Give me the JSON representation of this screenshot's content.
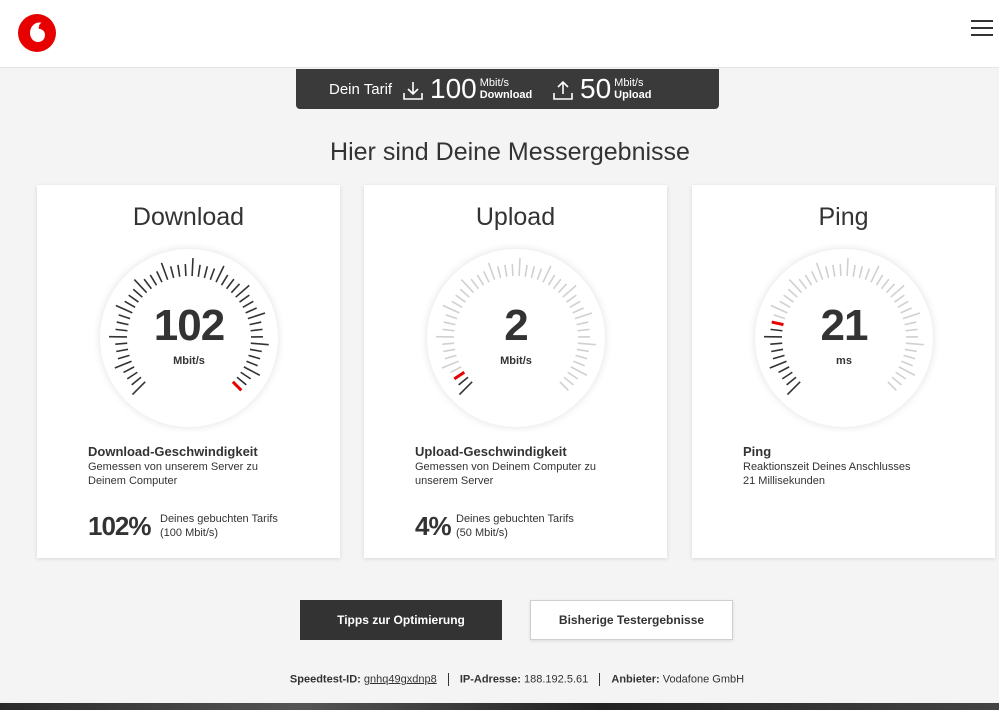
{
  "colors": {
    "accent": "#e60000",
    "dark": "#333333",
    "tick": "#333333",
    "tick_light": "#d0d0d0"
  },
  "header": {
    "logo_icon": "vodafone-logo-icon",
    "menu_icon": "hamburger-menu-icon"
  },
  "tarif": {
    "label": "Dein Tarif",
    "download": {
      "icon": "download-icon",
      "value": "100",
      "unit": "Mbit/s",
      "label": "Download"
    },
    "upload": {
      "icon": "upload-icon",
      "value": "50",
      "unit": "Mbit/s",
      "label": "Upload"
    }
  },
  "title": "Hier sind Deine Messergebnisse",
  "cards": [
    {
      "title": "Download",
      "value": "102",
      "unit": "Mbit/s",
      "level": 1.02,
      "heading": "Download-Geschwindigkeit",
      "desc": "Gemessen von unserem Server zu Deinem Computer",
      "pct": "102%",
      "pct_line1": "Deines gebuchten Tarifs",
      "pct_line2": "(100 Mbit/s)"
    },
    {
      "title": "Upload",
      "value": "2",
      "unit": "Mbit/s",
      "level": 0.04,
      "heading": "Upload-Geschwindigkeit",
      "desc": "Gemessen von Deinem Computer zu unserem Server",
      "pct": "4%",
      "pct_line1": "Deines gebuchten Tarifs",
      "pct_line2": "(50 Mbit/s)"
    },
    {
      "title": "Ping",
      "value": "21",
      "unit": "ms",
      "level": 0.22,
      "heading": "Ping",
      "desc": "Reaktionszeit Deines Anschlusses 21 Millisekunden",
      "pct": "",
      "pct_line1": "",
      "pct_line2": ""
    }
  ],
  "buttons": {
    "tips": "Tipps zur Optimierung",
    "history": "Bisherige Testergebnisse"
  },
  "footer": {
    "speedtest_label": "Speedtest-ID:",
    "speedtest_value": "gnhq49gxdnp8",
    "ip_label": "IP-Adresse:",
    "ip_value": "188.192.5.61",
    "provider_label": "Anbieter:",
    "provider_value": "Vodafone GmbH"
  }
}
